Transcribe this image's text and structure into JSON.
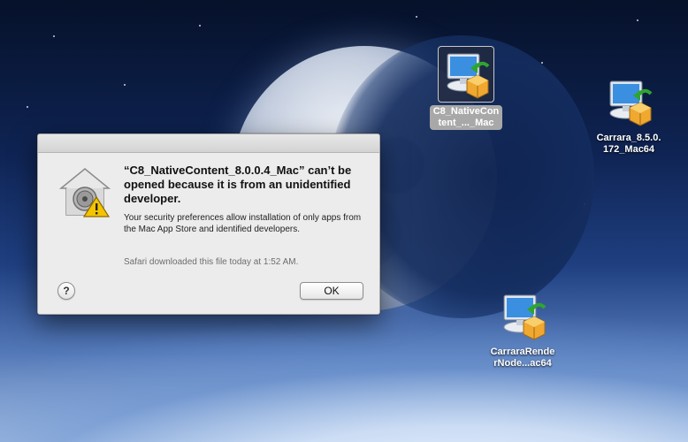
{
  "desktop": {
    "icons": [
      {
        "label": "C8_NativeCon\ntent_..._Mac",
        "selected": true
      },
      {
        "label": "Carrara_8.5.0.\n172_Mac64",
        "selected": false
      },
      {
        "label": "CarraraRende\nrNode...ac64",
        "selected": false
      }
    ]
  },
  "dialog": {
    "title": "“C8_NativeContent_8.0.0.4_Mac” can’t be opened because it is from an unidentified developer.",
    "message": "Your security preferences allow installation of only apps from the Mac App Store and identified developers.",
    "footnote": "Safari downloaded this file today at 1:52 AM.",
    "help_label": "?",
    "ok_label": "OK"
  },
  "colors": {
    "dialog_background": "#ececec",
    "warning_yellow": "#f5c400"
  }
}
